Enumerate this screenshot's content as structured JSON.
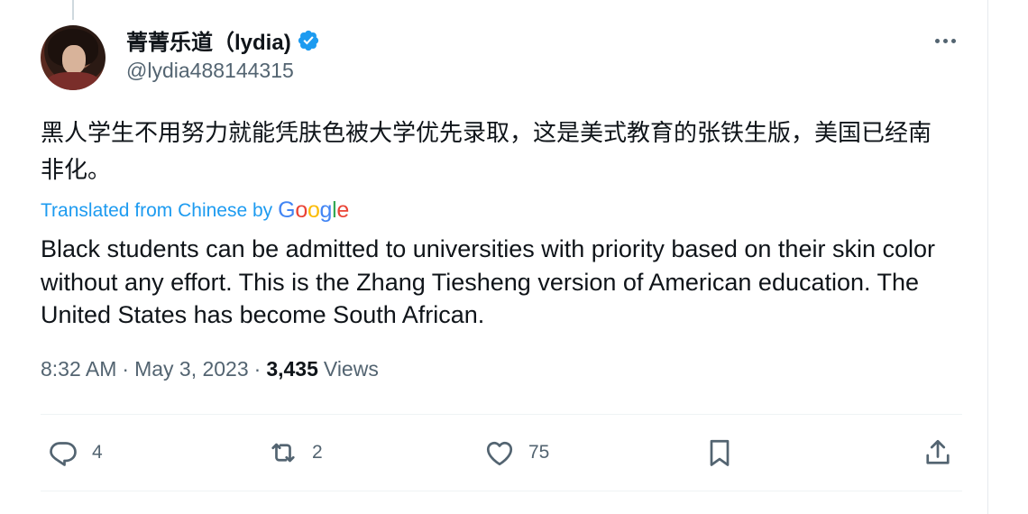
{
  "author": {
    "display_name": "菁菁乐道（lydia)",
    "handle": "@lydia488144315",
    "verified": true,
    "verified_color": "#1d9bf0"
  },
  "tweet": {
    "text_original": "黑人学生不用努力就能凭肤色被大学优先录取，这是美式教育的张铁生版，美国已经南非化。",
    "translation_label": "Translated from Chinese by",
    "translation_provider": "Google",
    "text_translated": "Black students can be admitted to universities with priority based on their skin color without any effort. This is the Zhang Tiesheng version of American education. The United States has become South African."
  },
  "meta": {
    "time": "8:32 AM",
    "date": "May 3, 2023",
    "separator": "·",
    "views_count": "3,435",
    "views_label": "Views"
  },
  "actions": {
    "reply_count": "4",
    "retweet_count": "2",
    "like_count": "75"
  },
  "icons": {
    "more": "more-horizontal-icon",
    "reply": "reply-icon",
    "retweet": "retweet-icon",
    "like": "heart-icon",
    "bookmark": "bookmark-icon",
    "share": "share-icon",
    "verified": "verified-badge-icon"
  },
  "colors": {
    "text_primary": "#0f1419",
    "text_secondary": "#536471",
    "link": "#1d9bf0"
  }
}
